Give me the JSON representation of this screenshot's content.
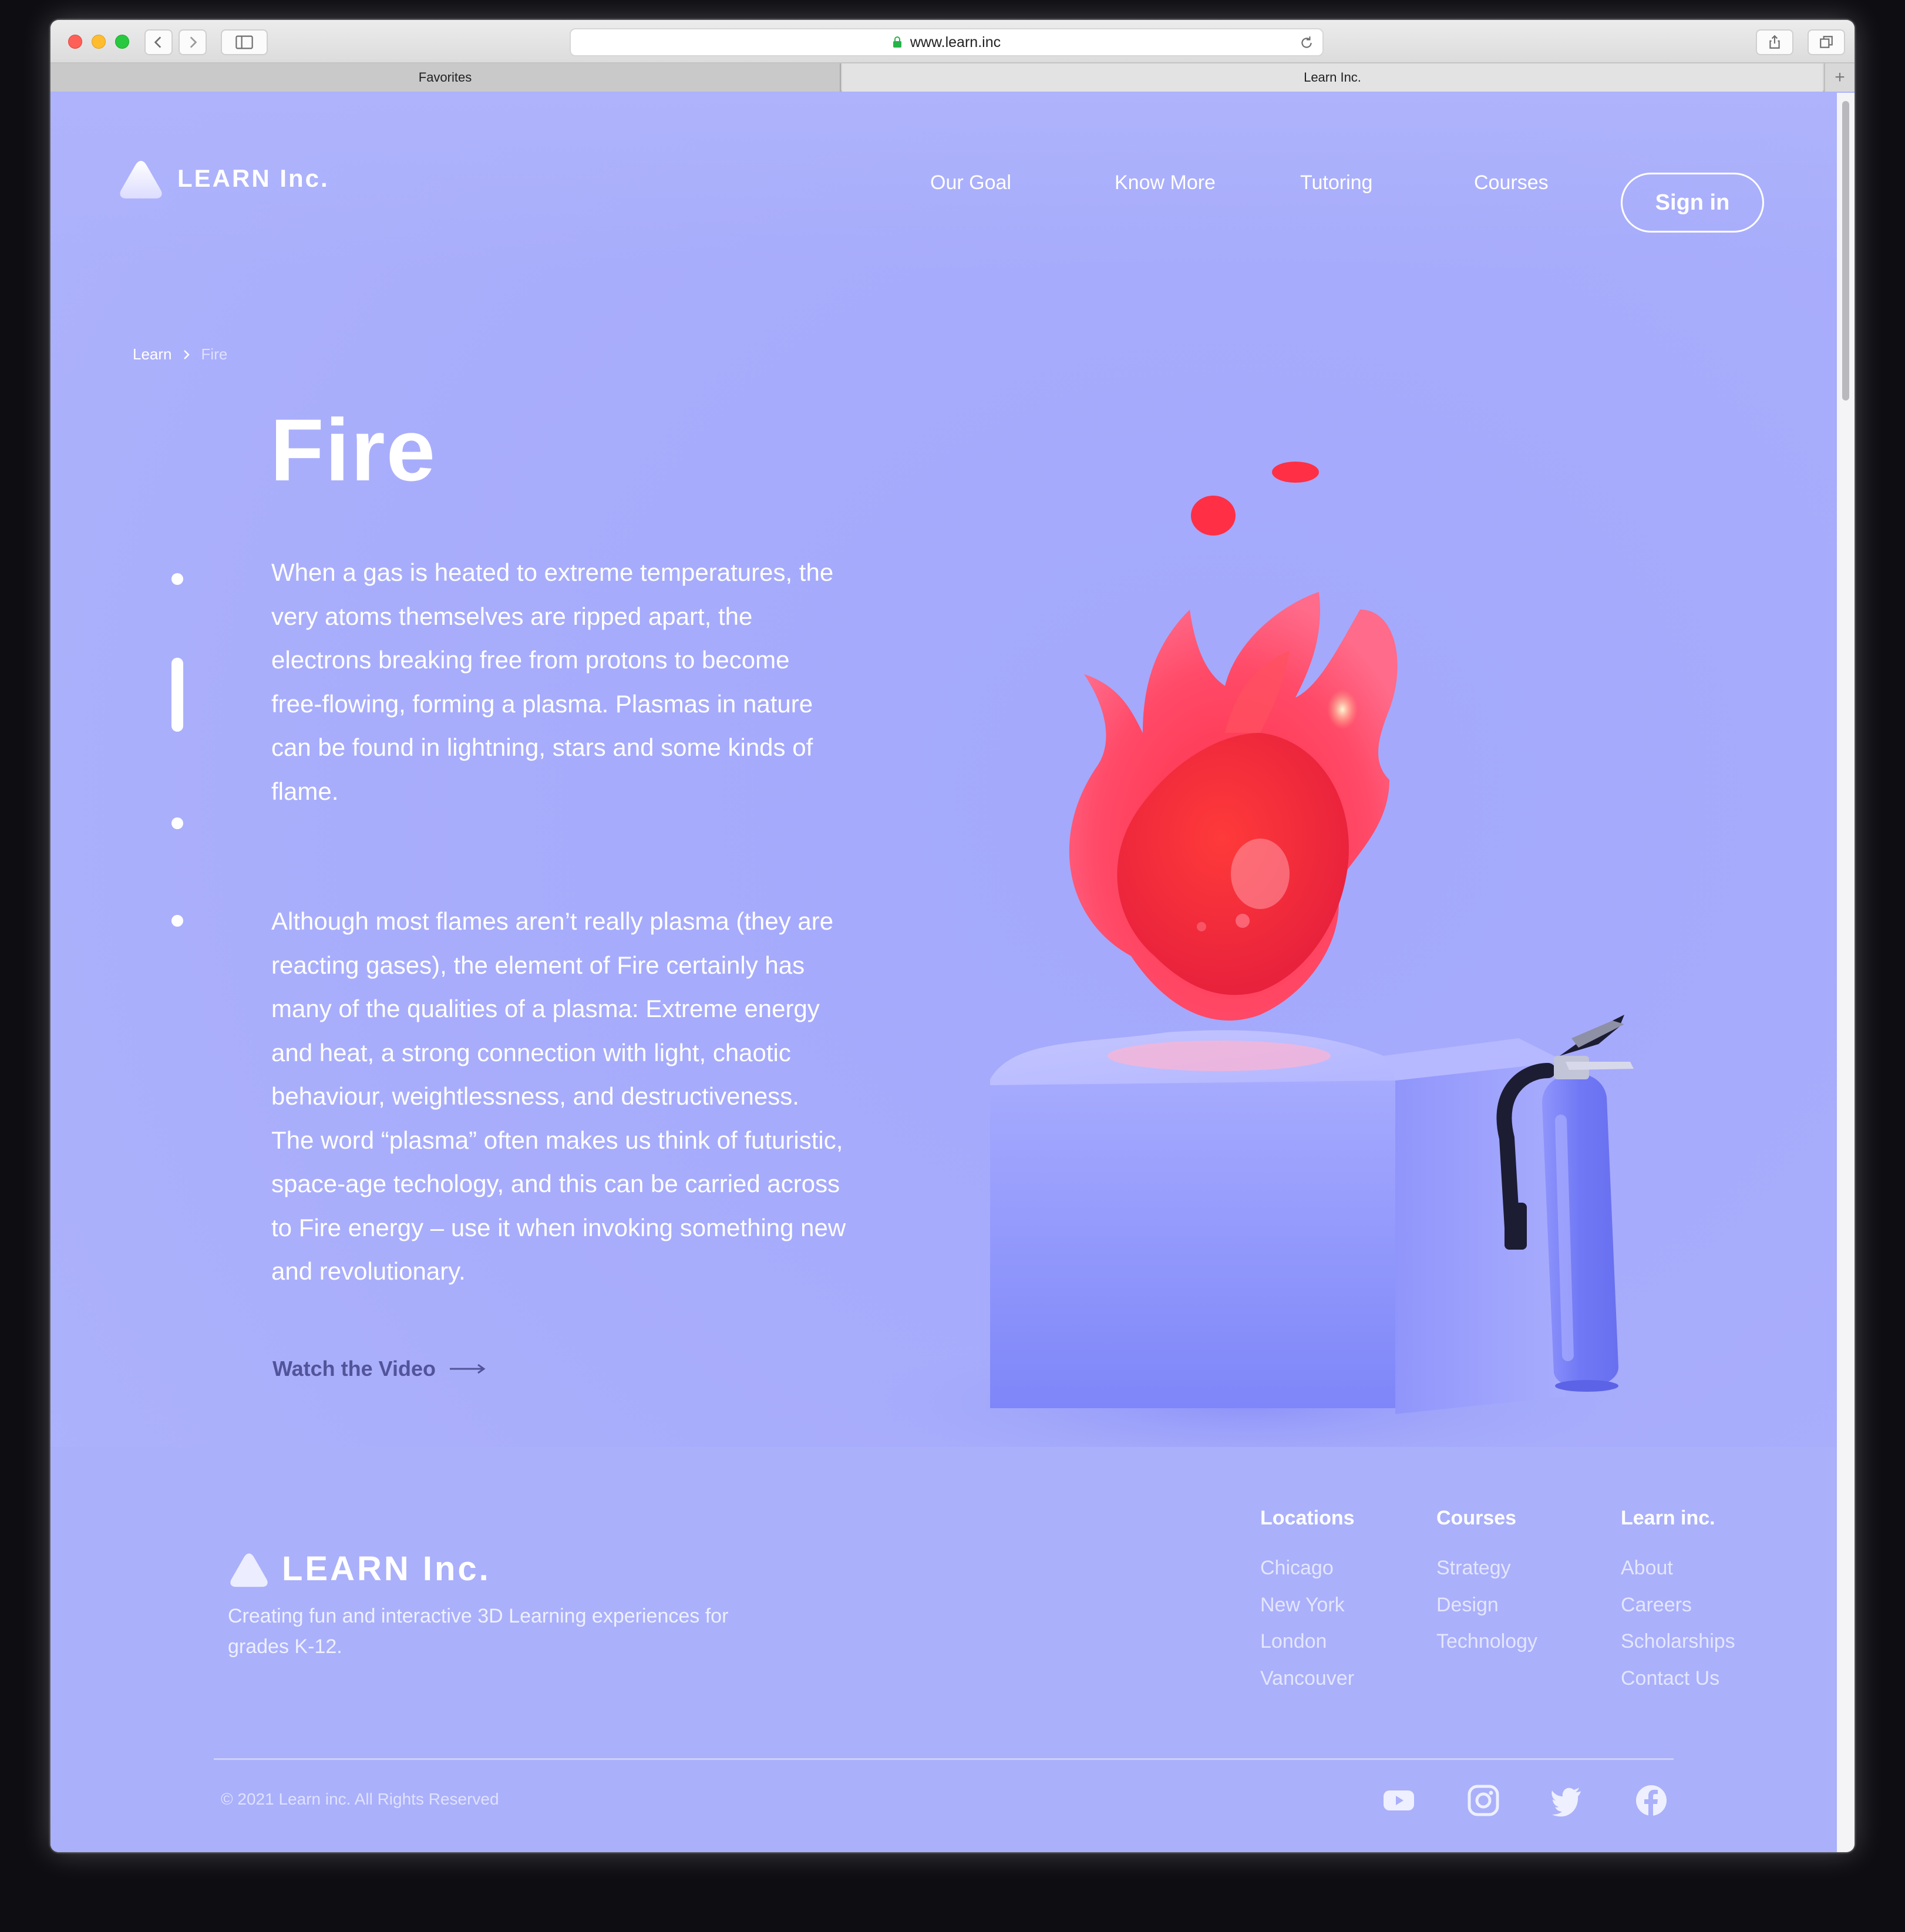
{
  "browser": {
    "url": "www.learn.inc",
    "tabs": [
      {
        "label": "Favorites"
      },
      {
        "label": "Learn Inc."
      }
    ]
  },
  "header": {
    "brand": "LEARN Inc.",
    "nav": [
      "Our Goal",
      "Know More",
      "Tutoring",
      "Courses"
    ],
    "signin": "Sign in"
  },
  "breadcrumb": {
    "parent": "Learn",
    "current": "Fire"
  },
  "article": {
    "title": "Fire",
    "paragraph1": "When a gas is heated to extreme temperatures, the very atoms themselves are ripped apart, the electrons breaking free from protons to become free-flowing, forming a plasma. Plasmas in nature can be found in lightning, stars and some kinds of flame.",
    "paragraph2": "Although most flames aren’t really plasma (they are reacting gases), the element of Fire certainly has many of the qualities of a plasma: Extreme energy and heat, a strong connection with light, chaotic behaviour, weightlessness, and destructiveness. The word “plasma” often makes us think of futuristic, space-age techology, and this can be carried across to Fire energy – use it when invoking something new and revolutionary.",
    "cta": "Watch the Video"
  },
  "footer": {
    "brand": "LEARN Inc.",
    "tagline": "Creating fun and interactive 3D Learning  experiences for grades K-12.",
    "columns": [
      {
        "heading": "Locations",
        "links": [
          "Chicago",
          "New York",
          "London",
          "Vancouver"
        ]
      },
      {
        "heading": "Courses",
        "links": [
          "Strategy",
          "Design",
          "Technology"
        ]
      },
      {
        "heading": "Learn inc.",
        "links": [
          "About",
          "Careers",
          "Scholarships",
          "Contact Us"
        ]
      }
    ],
    "copyright": "© 2021 Learn inc. All Rights Reserved",
    "social": [
      "youtube-icon",
      "instagram-icon",
      "twitter-icon",
      "facebook-icon"
    ]
  },
  "colors": {
    "page_bg": "#adb3fb",
    "accent_text": "#52549a",
    "flame": "#ff3d57"
  }
}
